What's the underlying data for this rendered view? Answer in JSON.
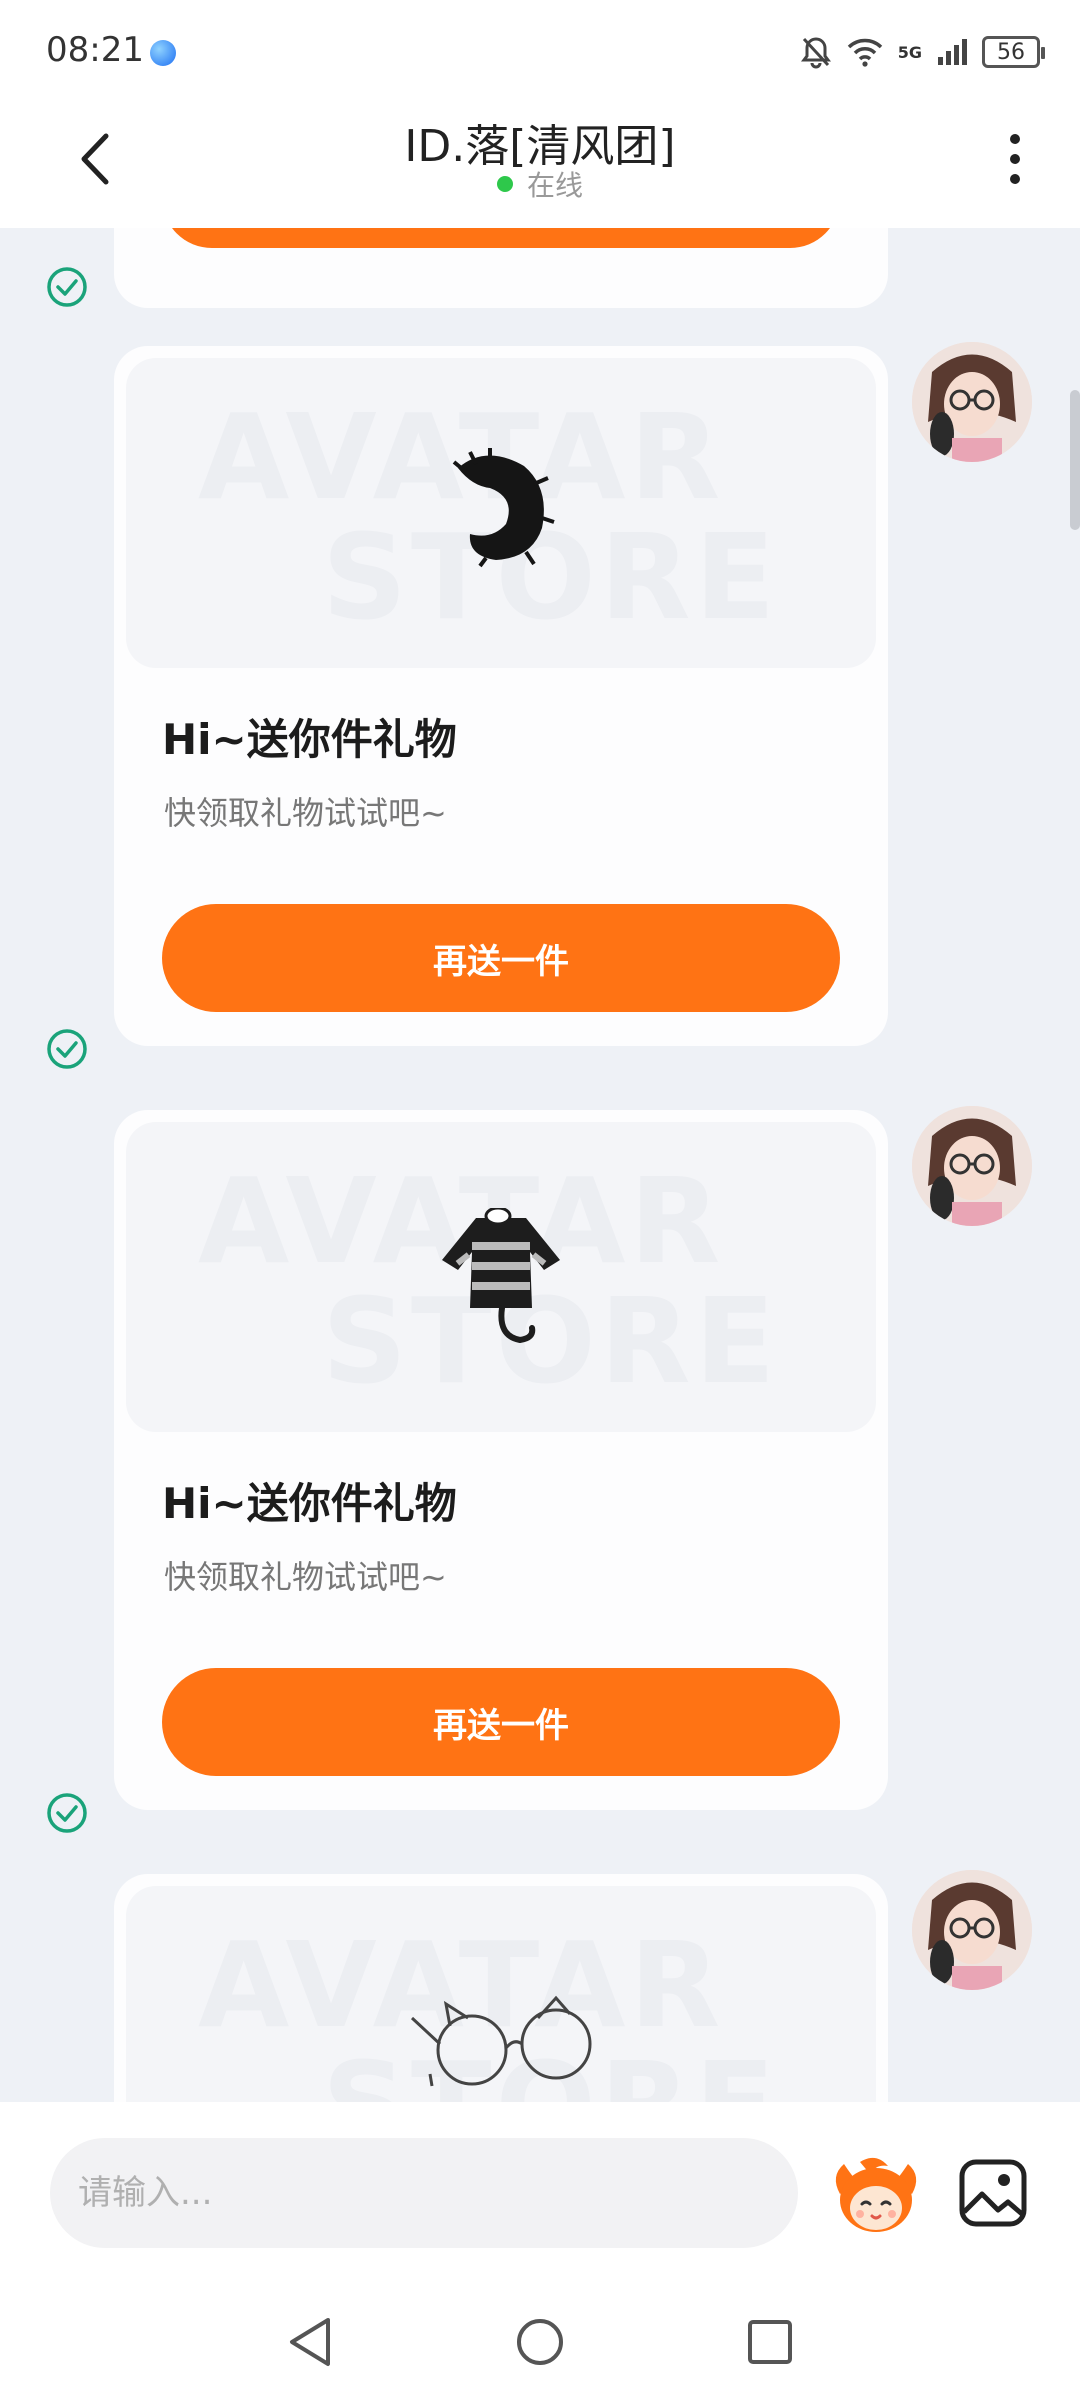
{
  "status_bar": {
    "time": "08:21",
    "network": "5G",
    "battery": "56"
  },
  "header": {
    "title": "ID.落[清风团]",
    "status": "在线",
    "status_color": "#2ec84b"
  },
  "messages": [
    {
      "title": "Hi~送你件礼物",
      "subtitle": "快领取礼物试试吧~",
      "button": "再送一件",
      "watermark_top": "AVATAR",
      "watermark_bottom": "STORE",
      "gift_icon": "fluffy-tail-icon",
      "read": true
    },
    {
      "title": "Hi~送你件礼物",
      "subtitle": "快领取礼物试试吧~",
      "button": "再送一件",
      "watermark_top": "AVATAR",
      "watermark_bottom": "STORE",
      "gift_icon": "striped-sweater-icon",
      "read": true
    },
    {
      "watermark_top": "AVATAR",
      "watermark_bottom": "STORE",
      "gift_icon": "cat-ear-glasses-icon"
    }
  ],
  "input": {
    "placeholder": "请输入..."
  },
  "colors": {
    "accent": "#ff7314",
    "read_check": "#1aa37a",
    "background": "#eef1f6"
  }
}
